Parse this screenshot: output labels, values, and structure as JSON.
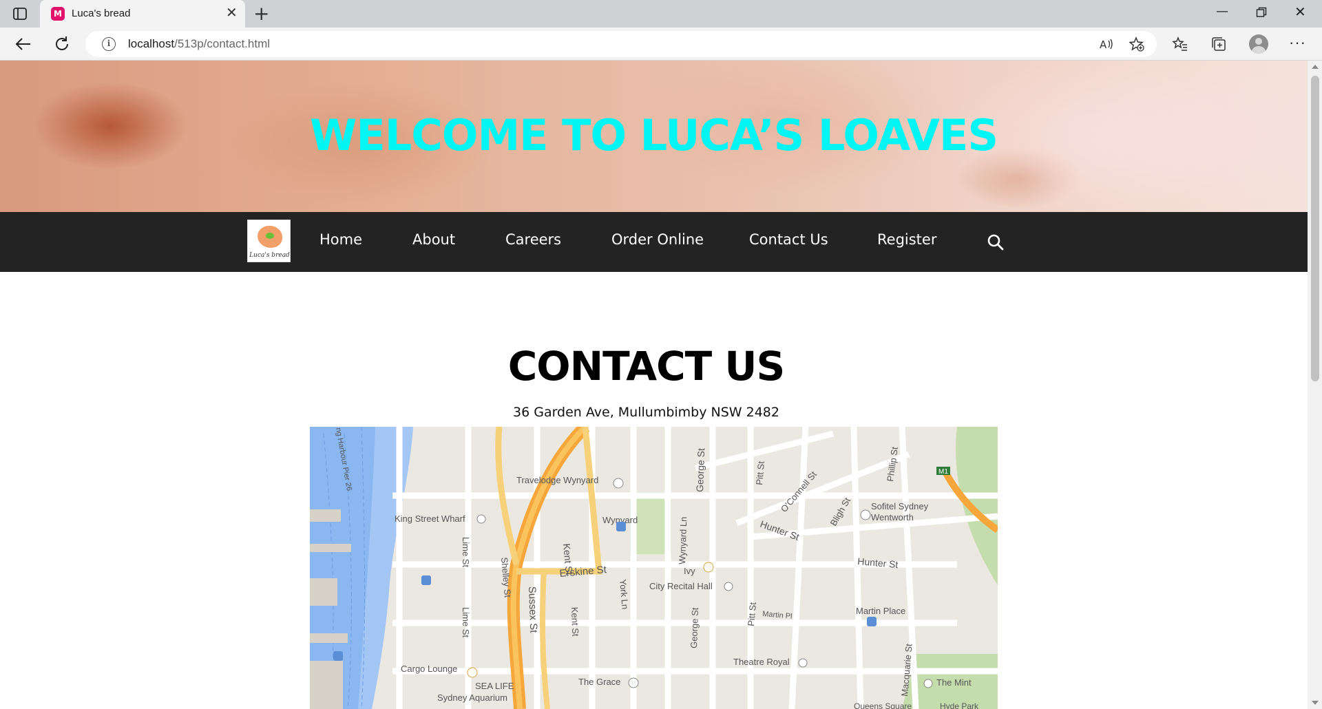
{
  "browser": {
    "tab_title": "Luca's bread",
    "url_host": "localhost",
    "url_path": "/513p/contact.html",
    "favicon_letter": "M",
    "accent": "#e3126b"
  },
  "hero": {
    "title": "WELCOME TO LUCA’S LOAVES",
    "title_color": "#00f5f5"
  },
  "nav": {
    "logo_text": "Luca's bread",
    "items": [
      "Home",
      "About",
      "Careers",
      "Order Online",
      "Contact Us",
      "Register"
    ],
    "background": "#232323"
  },
  "contact": {
    "title": "CONTACT US",
    "address": "36 Garden Ave, Mullumbimby NSW 2482"
  },
  "map": {
    "labels": {
      "pier": "ng Harbour Pier 26",
      "travelodge": "Travelodge Wynyard",
      "king_st_wharf": "King Street Wharf",
      "wynyard": "Wynyard",
      "kent_st": "Kent St",
      "lime_st": "Lime St",
      "shelley_st": "Shelley St",
      "erskine_st": "Erskine St",
      "york_ln": "York Ln",
      "sussex_st": "Sussex St",
      "george_st": "George St",
      "wynyard_ln": "Wynyard Ln",
      "pitt_st": "Pitt St",
      "oconnell_st": "O'Connell St",
      "bligh_st": "Bligh St",
      "phillip_st": "Phillip St",
      "hunter_st": "Hunter St",
      "sofitel": "Sofitel Sydney",
      "wentworth": "Wentworth",
      "ivy": "Ivy",
      "city_recital_hall": "City Recital Hall",
      "martin_place": "Martin Place",
      "martin_pl": "Martin Pl",
      "macquarie_st": "Macquarie St",
      "theatre_royal": "Theatre Royal",
      "cargo_lounge": "Cargo Lounge",
      "sea_life": "SEA LIFE",
      "sydney_aquarium": "Sydney Aquarium",
      "the_grace": "The Grace",
      "the_mint": "The Mint",
      "queens_square": "Queens Square",
      "hyde_park": "Hyde Park",
      "m1": "M1"
    }
  }
}
